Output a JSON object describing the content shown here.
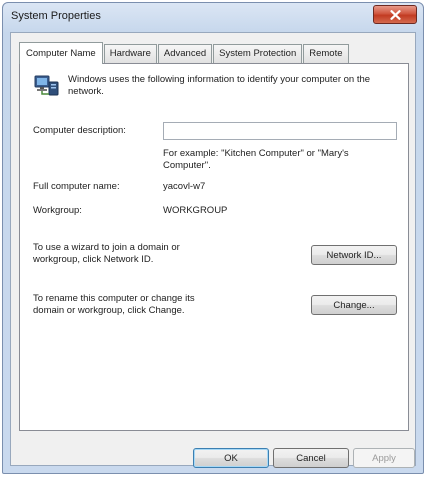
{
  "window": {
    "title": "System Properties",
    "close_icon": "close-icon"
  },
  "tabs": [
    {
      "label": "Computer Name",
      "active": true
    },
    {
      "label": "Hardware",
      "active": false
    },
    {
      "label": "Advanced",
      "active": false
    },
    {
      "label": "System Protection",
      "active": false
    },
    {
      "label": "Remote",
      "active": false
    }
  ],
  "computer_name": {
    "icon": "computer-network-icon",
    "intro": "Windows uses the following information to identify your computer on the network.",
    "description_label": "Computer description:",
    "description_value": "",
    "example": "For example: \"Kitchen Computer\" or \"Mary's Computer\".",
    "full_name_label": "Full computer name:",
    "full_name_value": "yacovl-w7",
    "workgroup_label": "Workgroup:",
    "workgroup_value": "WORKGROUP",
    "network_id_text": "To use a wizard to join a domain or workgroup, click Network ID.",
    "network_id_button": "Network ID...",
    "rename_text": "To rename this computer or change its domain or workgroup, click Change.",
    "change_button": "Change..."
  },
  "footer": {
    "ok": "OK",
    "cancel": "Cancel",
    "apply": "Apply"
  },
  "colors": {
    "title_bar": "#c6d7ec",
    "close_button": "#c23b22",
    "default_button_border": "#3c7fb1"
  }
}
